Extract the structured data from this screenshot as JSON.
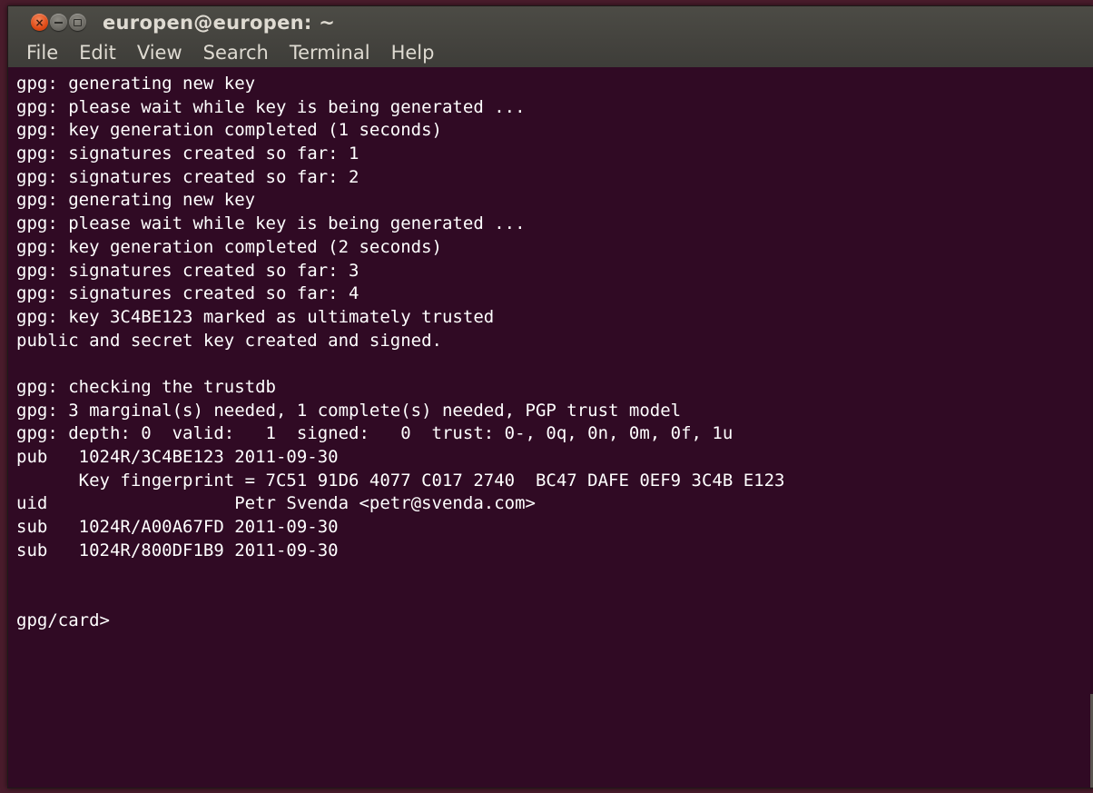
{
  "window": {
    "title": "europen@europen: ~",
    "buttons": {
      "close": "×"
    }
  },
  "menu": [
    "File",
    "Edit",
    "View",
    "Search",
    "Terminal",
    "Help"
  ],
  "terminal": {
    "lines": [
      "gpg: generating new key",
      "gpg: please wait while key is being generated ...",
      "gpg: key generation completed (1 seconds)",
      "gpg: signatures created so far: 1",
      "gpg: signatures created so far: 2",
      "gpg: generating new key",
      "gpg: please wait while key is being generated ...",
      "gpg: key generation completed (2 seconds)",
      "gpg: signatures created so far: 3",
      "gpg: signatures created so far: 4",
      "gpg: key 3C4BE123 marked as ultimately trusted",
      "public and secret key created and signed.",
      "",
      "gpg: checking the trustdb",
      "gpg: 3 marginal(s) needed, 1 complete(s) needed, PGP trust model",
      "gpg: depth: 0  valid:   1  signed:   0  trust: 0-, 0q, 0n, 0m, 0f, 1u",
      "pub   1024R/3C4BE123 2011-09-30",
      "      Key fingerprint = 7C51 91D6 4077 C017 2740  BC47 DAFE 0EF9 3C4B E123",
      "uid                  Petr Svenda <petr@svenda.com>",
      "sub   1024R/A00A67FD 2011-09-30",
      "sub   1024R/800DF1B9 2011-09-30",
      "",
      "",
      "gpg/card>"
    ]
  },
  "colors": {
    "terminal_bg": "#300a24",
    "terminal_fg": "#ffffff",
    "titlebar_bg": "#3e3d39",
    "close_button": "#df4a16"
  }
}
